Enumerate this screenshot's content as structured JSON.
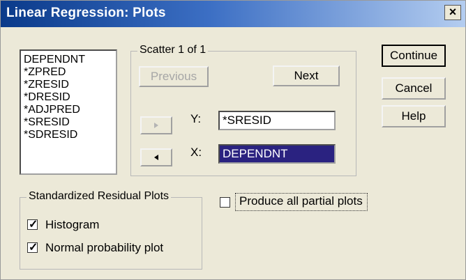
{
  "title": "Linear Regression: Plots",
  "close_glyph": "×",
  "variables": [
    "DEPENDNT",
    "*ZPRED",
    "*ZRESID",
    "*DRESID",
    "*ADJPRED",
    "*SRESID",
    "*SDRESID"
  ],
  "scatter": {
    "legend": "Scatter 1 of 1",
    "previous_label": "Previous",
    "next_label": "Next",
    "y_label": "Y:",
    "y_value": "*SRESID",
    "x_label": "X:",
    "x_value": "DEPENDNT"
  },
  "actions": {
    "continue": "Continue",
    "cancel": "Cancel",
    "help": "Help"
  },
  "residual_plots": {
    "legend": "Standardized Residual Plots",
    "histogram_label": "Histogram",
    "histogram_checked": true,
    "normal_label": "Normal probability plot",
    "normal_checked": true
  },
  "partial": {
    "label": "Produce all partial plots",
    "checked": false
  },
  "colors": {
    "selection": "#2a2280",
    "title_start": "#0a3a8a",
    "title_end": "#b4cdf0"
  }
}
